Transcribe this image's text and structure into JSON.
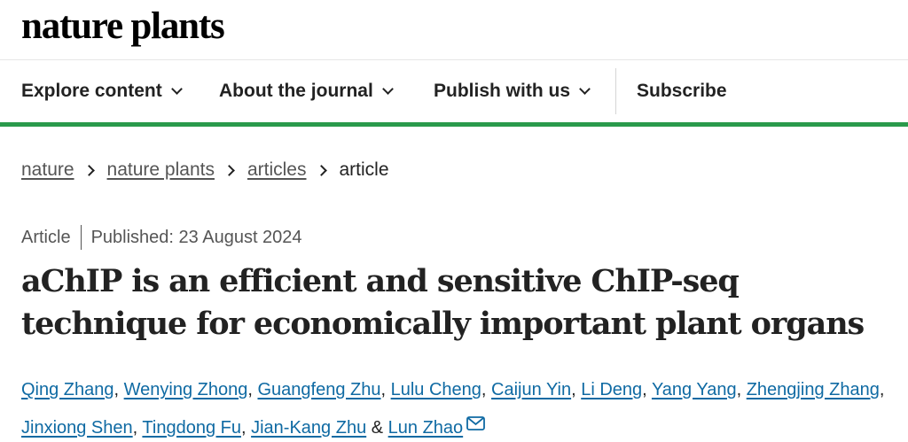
{
  "brand": {
    "logo_text": "nature plants"
  },
  "nav": {
    "items": [
      {
        "label": "Explore content",
        "has_dropdown": true
      },
      {
        "label": "About the journal",
        "has_dropdown": true
      },
      {
        "label": "Publish with us",
        "has_dropdown": true
      },
      {
        "label": "Subscribe",
        "has_dropdown": false
      }
    ],
    "accent_color": "#2a9a4b"
  },
  "breadcrumb": {
    "links": [
      "nature",
      "nature plants",
      "articles"
    ],
    "current": "article"
  },
  "article": {
    "type": "Article",
    "published": "Published: 23 August 2024",
    "title": "aChIP is an efficient and sensitive ChIP-seq technique for economically important plant organs",
    "authors": [
      "Qing Zhang",
      "Wenying Zhong",
      "Guangfeng Zhu",
      "Lulu Cheng",
      "Caijun Yin",
      "Li Deng",
      "Yang Yang",
      "Zhengjing Zhang",
      "Jinxiong Shen",
      "Tingdong Fu",
      "Jian-Kang Zhu",
      "Lun Zhao"
    ],
    "author_separator": ", ",
    "last_separator": " & ",
    "contact_icon": "mail-icon",
    "link_color": "#0f6aa3"
  }
}
